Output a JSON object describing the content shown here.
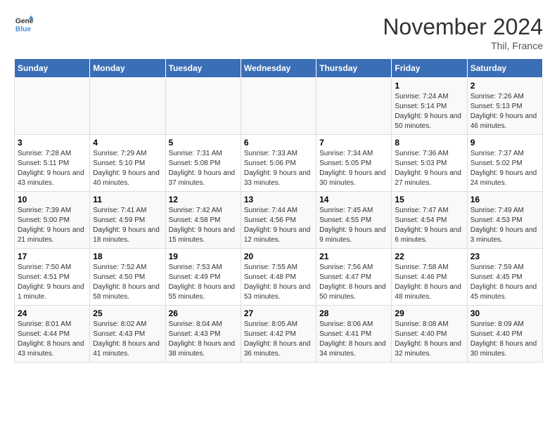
{
  "logo": {
    "line1": "General",
    "line2": "Blue"
  },
  "title": "November 2024",
  "subtitle": "Thil, France",
  "headers": [
    "Sunday",
    "Monday",
    "Tuesday",
    "Wednesday",
    "Thursday",
    "Friday",
    "Saturday"
  ],
  "weeks": [
    [
      {
        "day": "",
        "info": ""
      },
      {
        "day": "",
        "info": ""
      },
      {
        "day": "",
        "info": ""
      },
      {
        "day": "",
        "info": ""
      },
      {
        "day": "",
        "info": ""
      },
      {
        "day": "1",
        "info": "Sunrise: 7:24 AM\nSunset: 5:14 PM\nDaylight: 9 hours and 50 minutes."
      },
      {
        "day": "2",
        "info": "Sunrise: 7:26 AM\nSunset: 5:13 PM\nDaylight: 9 hours and 46 minutes."
      }
    ],
    [
      {
        "day": "3",
        "info": "Sunrise: 7:28 AM\nSunset: 5:11 PM\nDaylight: 9 hours and 43 minutes."
      },
      {
        "day": "4",
        "info": "Sunrise: 7:29 AM\nSunset: 5:10 PM\nDaylight: 9 hours and 40 minutes."
      },
      {
        "day": "5",
        "info": "Sunrise: 7:31 AM\nSunset: 5:08 PM\nDaylight: 9 hours and 37 minutes."
      },
      {
        "day": "6",
        "info": "Sunrise: 7:33 AM\nSunset: 5:06 PM\nDaylight: 9 hours and 33 minutes."
      },
      {
        "day": "7",
        "info": "Sunrise: 7:34 AM\nSunset: 5:05 PM\nDaylight: 9 hours and 30 minutes."
      },
      {
        "day": "8",
        "info": "Sunrise: 7:36 AM\nSunset: 5:03 PM\nDaylight: 9 hours and 27 minutes."
      },
      {
        "day": "9",
        "info": "Sunrise: 7:37 AM\nSunset: 5:02 PM\nDaylight: 9 hours and 24 minutes."
      }
    ],
    [
      {
        "day": "10",
        "info": "Sunrise: 7:39 AM\nSunset: 5:00 PM\nDaylight: 9 hours and 21 minutes."
      },
      {
        "day": "11",
        "info": "Sunrise: 7:41 AM\nSunset: 4:59 PM\nDaylight: 9 hours and 18 minutes."
      },
      {
        "day": "12",
        "info": "Sunrise: 7:42 AM\nSunset: 4:58 PM\nDaylight: 9 hours and 15 minutes."
      },
      {
        "day": "13",
        "info": "Sunrise: 7:44 AM\nSunset: 4:56 PM\nDaylight: 9 hours and 12 minutes."
      },
      {
        "day": "14",
        "info": "Sunrise: 7:45 AM\nSunset: 4:55 PM\nDaylight: 9 hours and 9 minutes."
      },
      {
        "day": "15",
        "info": "Sunrise: 7:47 AM\nSunset: 4:54 PM\nDaylight: 9 hours and 6 minutes."
      },
      {
        "day": "16",
        "info": "Sunrise: 7:49 AM\nSunset: 4:53 PM\nDaylight: 9 hours and 3 minutes."
      }
    ],
    [
      {
        "day": "17",
        "info": "Sunrise: 7:50 AM\nSunset: 4:51 PM\nDaylight: 9 hours and 1 minute."
      },
      {
        "day": "18",
        "info": "Sunrise: 7:52 AM\nSunset: 4:50 PM\nDaylight: 8 hours and 58 minutes."
      },
      {
        "day": "19",
        "info": "Sunrise: 7:53 AM\nSunset: 4:49 PM\nDaylight: 8 hours and 55 minutes."
      },
      {
        "day": "20",
        "info": "Sunrise: 7:55 AM\nSunset: 4:48 PM\nDaylight: 8 hours and 53 minutes."
      },
      {
        "day": "21",
        "info": "Sunrise: 7:56 AM\nSunset: 4:47 PM\nDaylight: 8 hours and 50 minutes."
      },
      {
        "day": "22",
        "info": "Sunrise: 7:58 AM\nSunset: 4:46 PM\nDaylight: 8 hours and 48 minutes."
      },
      {
        "day": "23",
        "info": "Sunrise: 7:59 AM\nSunset: 4:45 PM\nDaylight: 8 hours and 45 minutes."
      }
    ],
    [
      {
        "day": "24",
        "info": "Sunrise: 8:01 AM\nSunset: 4:44 PM\nDaylight: 8 hours and 43 minutes."
      },
      {
        "day": "25",
        "info": "Sunrise: 8:02 AM\nSunset: 4:43 PM\nDaylight: 8 hours and 41 minutes."
      },
      {
        "day": "26",
        "info": "Sunrise: 8:04 AM\nSunset: 4:43 PM\nDaylight: 8 hours and 38 minutes."
      },
      {
        "day": "27",
        "info": "Sunrise: 8:05 AM\nSunset: 4:42 PM\nDaylight: 8 hours and 36 minutes."
      },
      {
        "day": "28",
        "info": "Sunrise: 8:06 AM\nSunset: 4:41 PM\nDaylight: 8 hours and 34 minutes."
      },
      {
        "day": "29",
        "info": "Sunrise: 8:08 AM\nSunset: 4:40 PM\nDaylight: 8 hours and 32 minutes."
      },
      {
        "day": "30",
        "info": "Sunrise: 8:09 AM\nSunset: 4:40 PM\nDaylight: 8 hours and 30 minutes."
      }
    ]
  ]
}
